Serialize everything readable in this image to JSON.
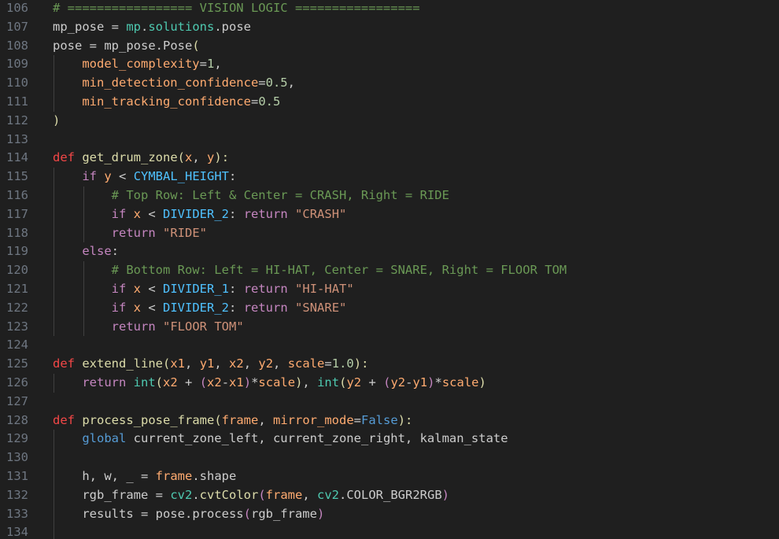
{
  "colors": {
    "background": "#1f1f1f",
    "line_number": "#6e7681",
    "indent_guide": "#404040"
  },
  "lines": [
    {
      "n": "106",
      "indent": 0,
      "tokens": [
        {
          "t": "# ================= VISION LOGIC =================",
          "c": "cmt"
        }
      ]
    },
    {
      "n": "107",
      "indent": 0,
      "tokens": [
        {
          "t": "mp_pose",
          "c": "plain"
        },
        {
          "t": " = ",
          "c": "plain"
        },
        {
          "t": "mp",
          "c": "cls"
        },
        {
          "t": ".",
          "c": "plain"
        },
        {
          "t": "solutions",
          "c": "cls"
        },
        {
          "t": ".pose",
          "c": "plain"
        }
      ]
    },
    {
      "n": "108",
      "indent": 0,
      "tokens": [
        {
          "t": "pose",
          "c": "plain"
        },
        {
          "t": " = ",
          "c": "plain"
        },
        {
          "t": "mp_pose",
          "c": "plain"
        },
        {
          "t": ".Pose",
          "c": "plain"
        },
        {
          "t": "(",
          "c": "fn"
        }
      ]
    },
    {
      "n": "109",
      "indent": 1,
      "tokens": [
        {
          "t": "    ",
          "c": "plain"
        },
        {
          "t": "model_complexity",
          "c": "param"
        },
        {
          "t": "=",
          "c": "plain"
        },
        {
          "t": "1",
          "c": "num"
        },
        {
          "t": ",",
          "c": "plain"
        }
      ]
    },
    {
      "n": "110",
      "indent": 1,
      "tokens": [
        {
          "t": "    ",
          "c": "plain"
        },
        {
          "t": "min_detection_confidence",
          "c": "param"
        },
        {
          "t": "=",
          "c": "plain"
        },
        {
          "t": "0.5",
          "c": "num"
        },
        {
          "t": ",",
          "c": "plain"
        }
      ]
    },
    {
      "n": "111",
      "indent": 1,
      "tokens": [
        {
          "t": "    ",
          "c": "plain"
        },
        {
          "t": "min_tracking_confidence",
          "c": "param"
        },
        {
          "t": "=",
          "c": "plain"
        },
        {
          "t": "0.5",
          "c": "num"
        }
      ]
    },
    {
      "n": "112",
      "indent": 0,
      "tokens": [
        {
          "t": ")",
          "c": "fn"
        }
      ]
    },
    {
      "n": "113",
      "indent": 0,
      "tokens": []
    },
    {
      "n": "114",
      "indent": 0,
      "tokens": [
        {
          "t": "def",
          "c": "def"
        },
        {
          "t": " ",
          "c": "plain"
        },
        {
          "t": "get_drum_zone",
          "c": "fn"
        },
        {
          "t": "(",
          "c": "fn"
        },
        {
          "t": "x",
          "c": "param"
        },
        {
          "t": ", ",
          "c": "plain"
        },
        {
          "t": "y",
          "c": "param"
        },
        {
          "t": "):",
          "c": "fn"
        }
      ]
    },
    {
      "n": "115",
      "indent": 1,
      "tokens": [
        {
          "t": "    ",
          "c": "plain"
        },
        {
          "t": "if",
          "c": "ctrl"
        },
        {
          "t": " ",
          "c": "plain"
        },
        {
          "t": "y",
          "c": "param"
        },
        {
          "t": " < ",
          "c": "plain"
        },
        {
          "t": "CYMBAL_HEIGHT",
          "c": "const"
        },
        {
          "t": ":",
          "c": "plain"
        }
      ]
    },
    {
      "n": "116",
      "indent": 2,
      "tokens": [
        {
          "t": "        ",
          "c": "plain"
        },
        {
          "t": "# Top Row: Left & Center = CRASH, Right = RIDE",
          "c": "cmt"
        }
      ]
    },
    {
      "n": "117",
      "indent": 2,
      "tokens": [
        {
          "t": "        ",
          "c": "plain"
        },
        {
          "t": "if",
          "c": "ctrl"
        },
        {
          "t": " ",
          "c": "plain"
        },
        {
          "t": "x",
          "c": "param"
        },
        {
          "t": " < ",
          "c": "plain"
        },
        {
          "t": "DIVIDER_2",
          "c": "const"
        },
        {
          "t": ": ",
          "c": "plain"
        },
        {
          "t": "return",
          "c": "ctrl"
        },
        {
          "t": " ",
          "c": "plain"
        },
        {
          "t": "\"CRASH\"",
          "c": "str"
        }
      ]
    },
    {
      "n": "118",
      "indent": 2,
      "tokens": [
        {
          "t": "        ",
          "c": "plain"
        },
        {
          "t": "return",
          "c": "ctrl"
        },
        {
          "t": " ",
          "c": "plain"
        },
        {
          "t": "\"RIDE\"",
          "c": "str"
        }
      ]
    },
    {
      "n": "119",
      "indent": 1,
      "tokens": [
        {
          "t": "    ",
          "c": "plain"
        },
        {
          "t": "else",
          "c": "ctrl"
        },
        {
          "t": ":",
          "c": "plain"
        }
      ]
    },
    {
      "n": "120",
      "indent": 2,
      "tokens": [
        {
          "t": "        ",
          "c": "plain"
        },
        {
          "t": "# Bottom Row: Left = HI-HAT, Center = SNARE, Right = FLOOR TOM",
          "c": "cmt"
        }
      ]
    },
    {
      "n": "121",
      "indent": 2,
      "tokens": [
        {
          "t": "        ",
          "c": "plain"
        },
        {
          "t": "if",
          "c": "ctrl"
        },
        {
          "t": " ",
          "c": "plain"
        },
        {
          "t": "x",
          "c": "param"
        },
        {
          "t": " < ",
          "c": "plain"
        },
        {
          "t": "DIVIDER_1",
          "c": "const"
        },
        {
          "t": ": ",
          "c": "plain"
        },
        {
          "t": "return",
          "c": "ctrl"
        },
        {
          "t": " ",
          "c": "plain"
        },
        {
          "t": "\"HI-HAT\"",
          "c": "str"
        }
      ]
    },
    {
      "n": "122",
      "indent": 2,
      "tokens": [
        {
          "t": "        ",
          "c": "plain"
        },
        {
          "t": "if",
          "c": "ctrl"
        },
        {
          "t": " ",
          "c": "plain"
        },
        {
          "t": "x",
          "c": "param"
        },
        {
          "t": " < ",
          "c": "plain"
        },
        {
          "t": "DIVIDER_2",
          "c": "const"
        },
        {
          "t": ": ",
          "c": "plain"
        },
        {
          "t": "return",
          "c": "ctrl"
        },
        {
          "t": " ",
          "c": "plain"
        },
        {
          "t": "\"SNARE\"",
          "c": "str"
        }
      ]
    },
    {
      "n": "123",
      "indent": 2,
      "tokens": [
        {
          "t": "        ",
          "c": "plain"
        },
        {
          "t": "return",
          "c": "ctrl"
        },
        {
          "t": " ",
          "c": "plain"
        },
        {
          "t": "\"FLOOR TOM\"",
          "c": "str"
        }
      ]
    },
    {
      "n": "124",
      "indent": 0,
      "tokens": []
    },
    {
      "n": "125",
      "indent": 0,
      "tokens": [
        {
          "t": "def",
          "c": "def"
        },
        {
          "t": " ",
          "c": "plain"
        },
        {
          "t": "extend_line",
          "c": "fn"
        },
        {
          "t": "(",
          "c": "fn"
        },
        {
          "t": "x1",
          "c": "param"
        },
        {
          "t": ", ",
          "c": "plain"
        },
        {
          "t": "y1",
          "c": "param"
        },
        {
          "t": ", ",
          "c": "plain"
        },
        {
          "t": "x2",
          "c": "param"
        },
        {
          "t": ", ",
          "c": "plain"
        },
        {
          "t": "y2",
          "c": "param"
        },
        {
          "t": ", ",
          "c": "plain"
        },
        {
          "t": "scale",
          "c": "param"
        },
        {
          "t": "=",
          "c": "plain"
        },
        {
          "t": "1.0",
          "c": "num"
        },
        {
          "t": "):",
          "c": "fn"
        }
      ]
    },
    {
      "n": "126",
      "indent": 1,
      "tokens": [
        {
          "t": "    ",
          "c": "plain"
        },
        {
          "t": "return",
          "c": "ctrl"
        },
        {
          "t": " ",
          "c": "plain"
        },
        {
          "t": "int",
          "c": "builtin"
        },
        {
          "t": "(",
          "c": "fn"
        },
        {
          "t": "x2",
          "c": "param"
        },
        {
          "t": " + ",
          "c": "plain"
        },
        {
          "t": "(",
          "c": "ctrl"
        },
        {
          "t": "x2",
          "c": "param"
        },
        {
          "t": "-",
          "c": "plain"
        },
        {
          "t": "x1",
          "c": "param"
        },
        {
          "t": ")",
          "c": "ctrl"
        },
        {
          "t": "*",
          "c": "plain"
        },
        {
          "t": "scale",
          "c": "param"
        },
        {
          "t": ")",
          "c": "fn"
        },
        {
          "t": ", ",
          "c": "plain"
        },
        {
          "t": "int",
          "c": "builtin"
        },
        {
          "t": "(",
          "c": "fn"
        },
        {
          "t": "y2",
          "c": "param"
        },
        {
          "t": " + ",
          "c": "plain"
        },
        {
          "t": "(",
          "c": "ctrl"
        },
        {
          "t": "y2",
          "c": "param"
        },
        {
          "t": "-",
          "c": "plain"
        },
        {
          "t": "y1",
          "c": "param"
        },
        {
          "t": ")",
          "c": "ctrl"
        },
        {
          "t": "*",
          "c": "plain"
        },
        {
          "t": "scale",
          "c": "param"
        },
        {
          "t": ")",
          "c": "fn"
        }
      ]
    },
    {
      "n": "127",
      "indent": 0,
      "tokens": []
    },
    {
      "n": "128",
      "indent": 0,
      "tokens": [
        {
          "t": "def",
          "c": "def"
        },
        {
          "t": " ",
          "c": "plain"
        },
        {
          "t": "process_pose_frame",
          "c": "fn"
        },
        {
          "t": "(",
          "c": "fn"
        },
        {
          "t": "frame",
          "c": "param"
        },
        {
          "t": ", ",
          "c": "plain"
        },
        {
          "t": "mirror_mode",
          "c": "param"
        },
        {
          "t": "=",
          "c": "plain"
        },
        {
          "t": "False",
          "c": "kw"
        },
        {
          "t": "):",
          "c": "fn"
        }
      ]
    },
    {
      "n": "129",
      "indent": 1,
      "tokens": [
        {
          "t": "    ",
          "c": "plain"
        },
        {
          "t": "global",
          "c": "kw"
        },
        {
          "t": " current_zone_left, current_zone_right, kalman_state",
          "c": "plain"
        }
      ]
    },
    {
      "n": "130",
      "indent": 1,
      "tokens": []
    },
    {
      "n": "131",
      "indent": 1,
      "tokens": [
        {
          "t": "    ",
          "c": "plain"
        },
        {
          "t": "h, w, _ = ",
          "c": "plain"
        },
        {
          "t": "frame",
          "c": "param"
        },
        {
          "t": ".shape",
          "c": "plain"
        }
      ]
    },
    {
      "n": "132",
      "indent": 1,
      "tokens": [
        {
          "t": "    ",
          "c": "plain"
        },
        {
          "t": "rgb_frame = ",
          "c": "plain"
        },
        {
          "t": "cv2",
          "c": "cls"
        },
        {
          "t": ".",
          "c": "plain"
        },
        {
          "t": "cvtColor",
          "c": "fn"
        },
        {
          "t": "(",
          "c": "ctrl"
        },
        {
          "t": "frame",
          "c": "param"
        },
        {
          "t": ", ",
          "c": "plain"
        },
        {
          "t": "cv2",
          "c": "cls"
        },
        {
          "t": ".COLOR_BGR2RGB",
          "c": "plain"
        },
        {
          "t": ")",
          "c": "ctrl"
        }
      ]
    },
    {
      "n": "133",
      "indent": 1,
      "tokens": [
        {
          "t": "    ",
          "c": "plain"
        },
        {
          "t": "results = pose.",
          "c": "plain"
        },
        {
          "t": "process",
          "c": "plain"
        },
        {
          "t": "(",
          "c": "ctrl"
        },
        {
          "t": "rgb_frame",
          "c": "plain"
        },
        {
          "t": ")",
          "c": "ctrl"
        }
      ]
    },
    {
      "n": "134",
      "indent": 1,
      "tokens": []
    }
  ]
}
